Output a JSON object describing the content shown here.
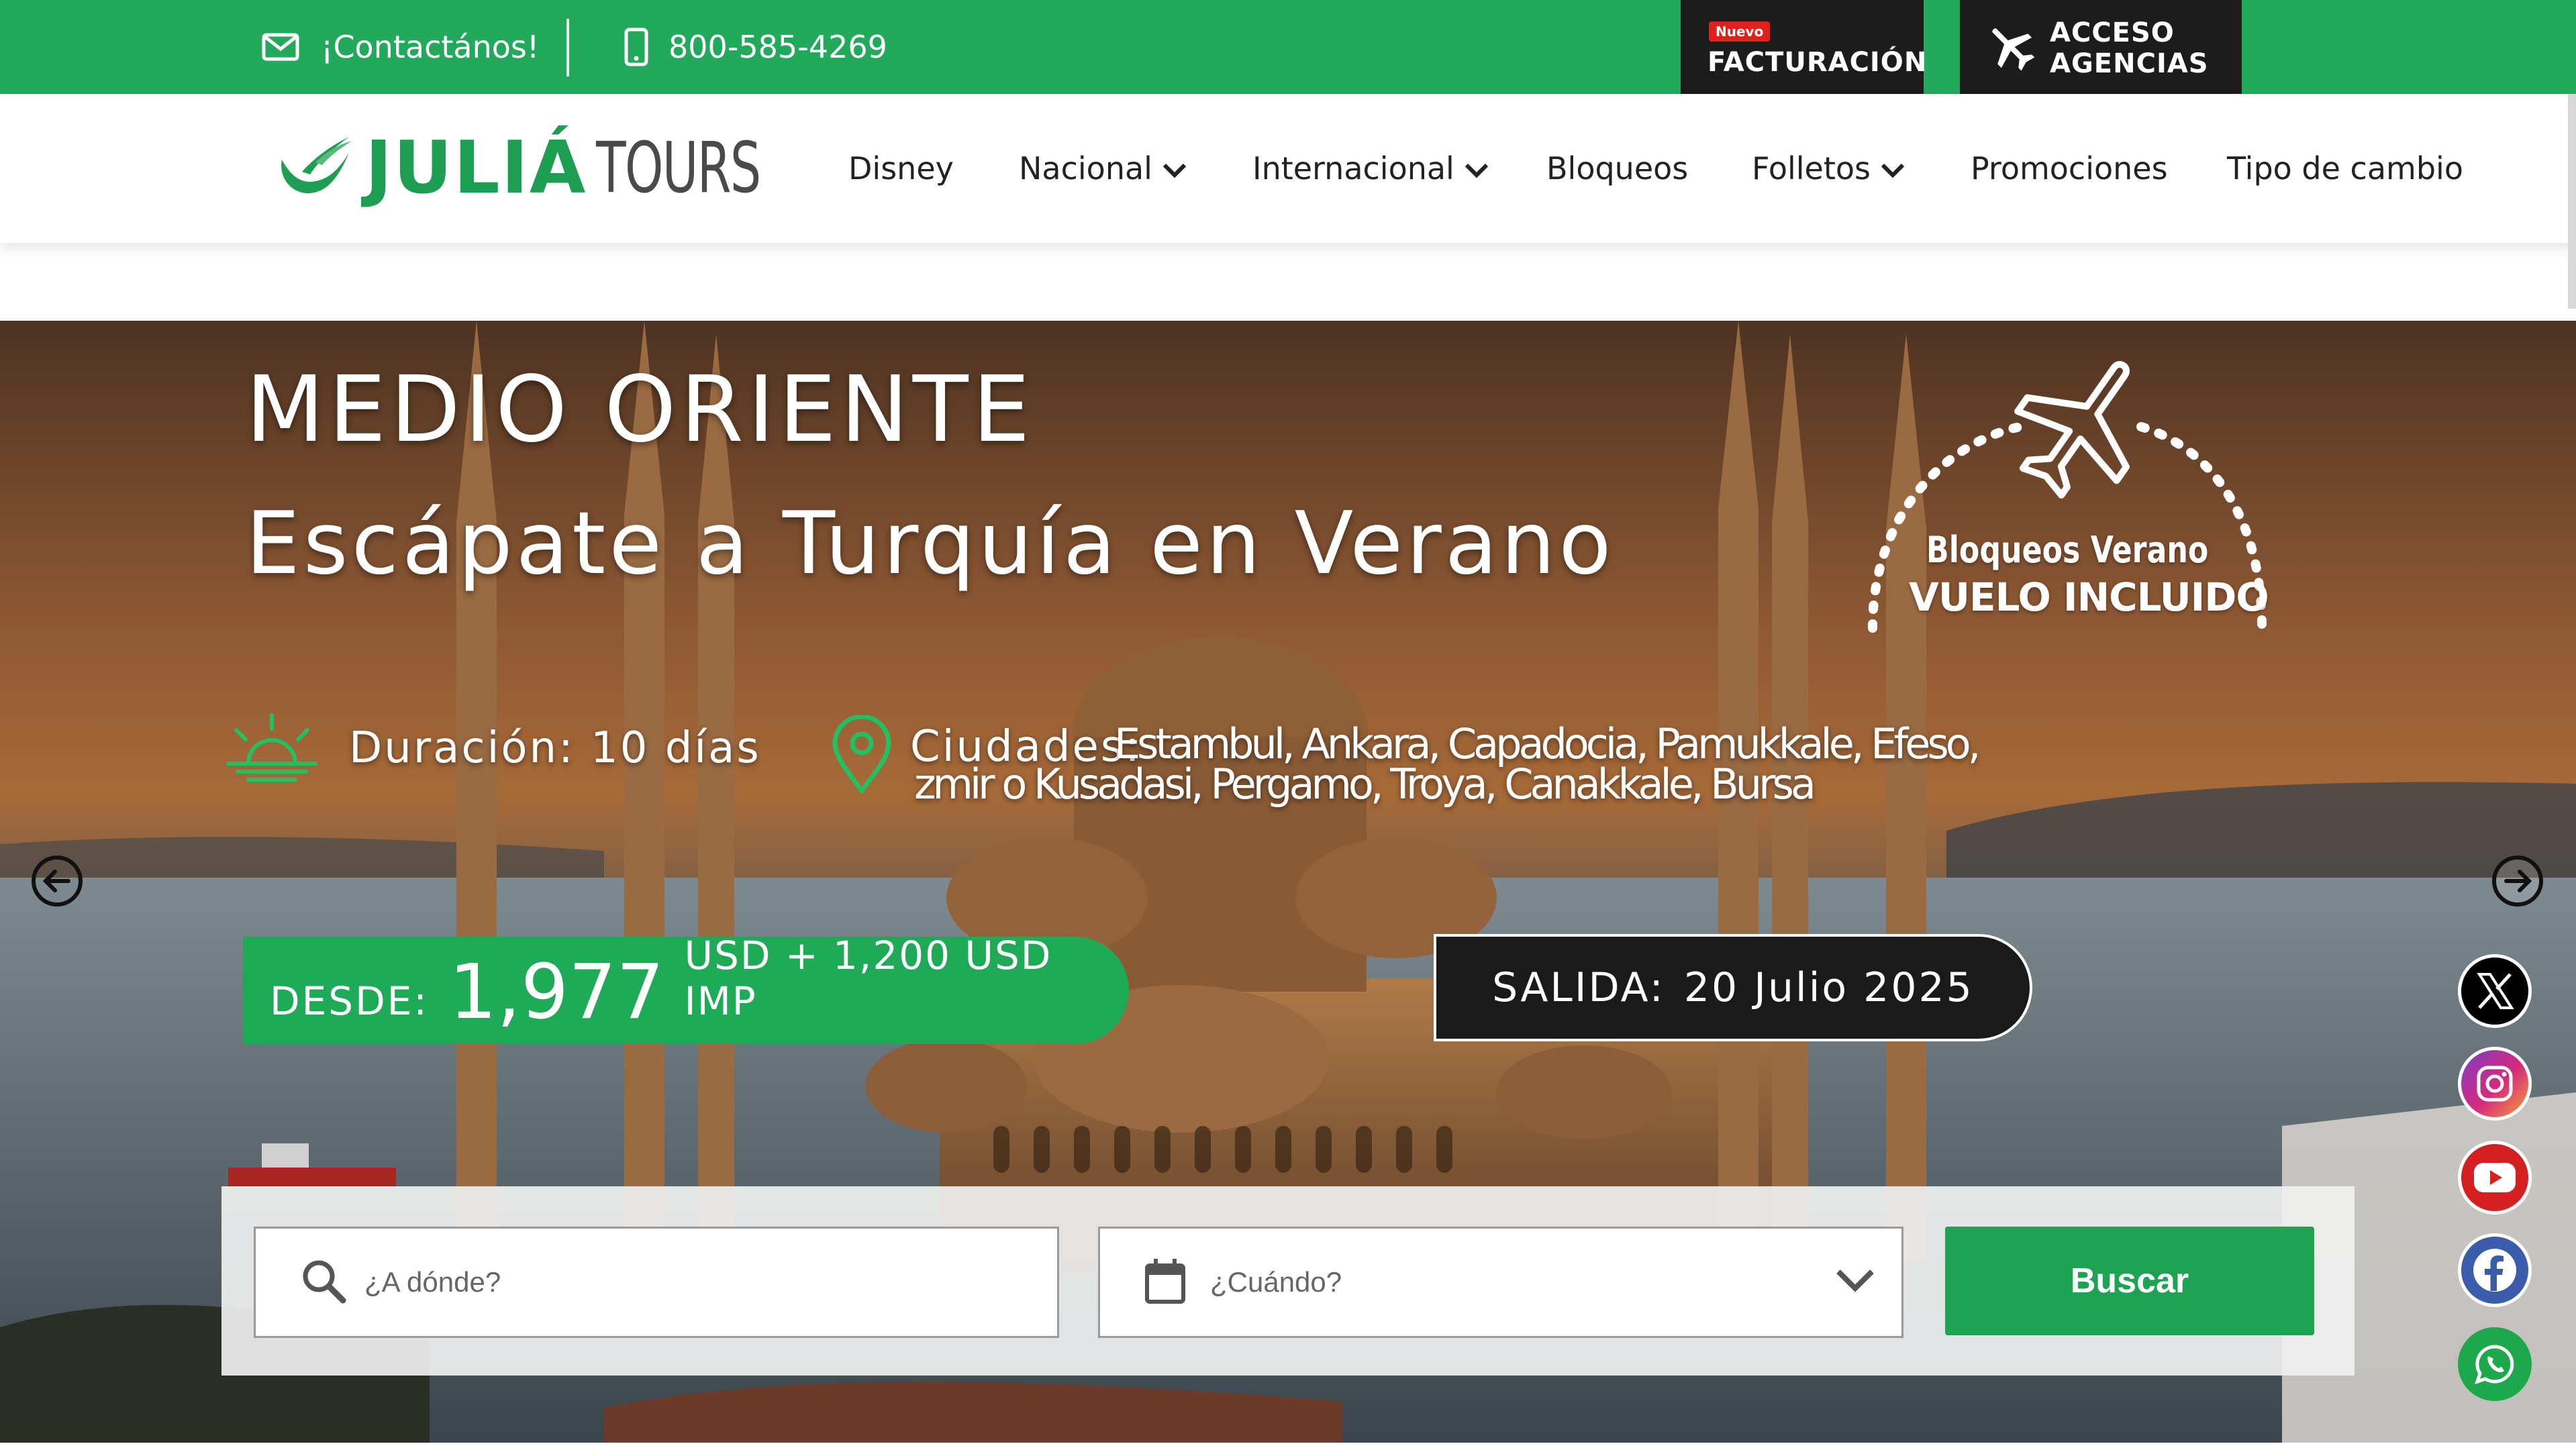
{
  "topbar": {
    "contact_label": "¡Contactános!",
    "phone": "800-585-4269",
    "facturacion_badge": "Nuevo",
    "facturacion_label": "FACTURACIÓN",
    "agencias_label": "ACCESO AGENCIAS"
  },
  "logo": {
    "brand_bold": "JULIÁ",
    "brand_light": "TOURS"
  },
  "nav": {
    "items": [
      {
        "label": "Disney"
      },
      {
        "label": "Nacional"
      },
      {
        "label": "Internacional"
      },
      {
        "label": "Bloqueos"
      },
      {
        "label": "Folletos"
      },
      {
        "label": "Promociones"
      },
      {
        "label": "Tipo de cambio"
      }
    ]
  },
  "hero": {
    "title": "MEDIO ORIENTE",
    "subtitle": "Escápate a Turquía en Verano",
    "badge_line1": "Bloqueos  Verano",
    "badge_line2": "VUELO INCLUIDO",
    "duration": "Duración: 10 días",
    "cities_label": "Ciudades:",
    "cities_line1": "Estambul, Ankara, Capadocia, Pamukkale, Efeso,",
    "cities_line2": "zmir o Kusadasi, Pergamo, Troya, Canakkale, Bursa",
    "price_from": "DESDE:",
    "price_value": "1,977",
    "price_rest": "USD + 1,200 USD IMP",
    "salida_label": "SALIDA:",
    "salida_date": "20 Julio 2025"
  },
  "search": {
    "where_placeholder": "¿A dónde?",
    "when_placeholder": "¿Cuándo?",
    "button_label": "Buscar"
  },
  "social": [
    "x-icon",
    "instagram-icon",
    "youtube-icon",
    "facebook-icon",
    "whatsapp-icon"
  ],
  "colors": {
    "brand_green": "#22a95b",
    "dark": "#1c1c1c",
    "badge_red": "#e0201c"
  }
}
